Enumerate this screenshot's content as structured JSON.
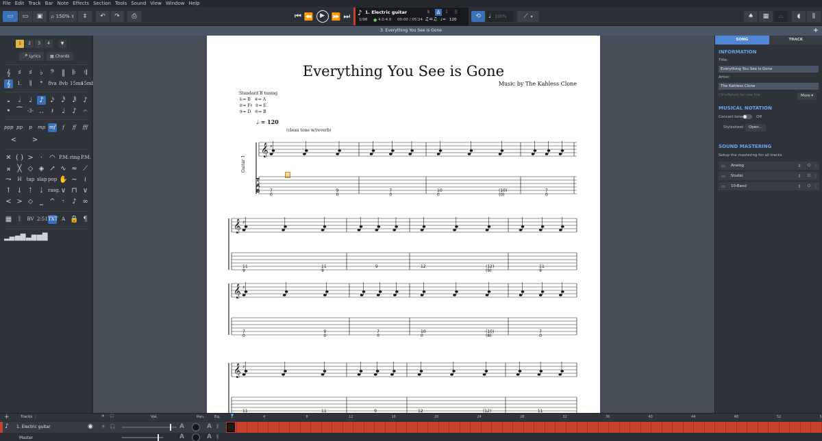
{
  "menu": [
    "File",
    "Edit",
    "Track",
    "Bar",
    "Note",
    "Effects",
    "Section",
    "Tools",
    "Sound",
    "View",
    "Window",
    "Help"
  ],
  "toolbar": {
    "zoom": "150%",
    "track_name": "1. Electric guitar",
    "bar_position": "1/98",
    "time_signature": "4.0:4.0",
    "time_position": "00:00 / 05:24",
    "tempo": "120",
    "track_number": "1",
    "string_label": "8",
    "speed": "100%"
  },
  "tab_title": "3. Everything You See is Gone",
  "palette": {
    "track_numbers": [
      "1",
      "2",
      "3",
      "4"
    ],
    "lyrics_label": "Lyrics",
    "chords_label": "Chords",
    "timecode": "2:51",
    "bv": "BV",
    "txt": "TXT"
  },
  "score": {
    "title": "Everything You See is Gone",
    "artist": "Music by The Kahless Clone",
    "tuning_title": "Standard B tuning",
    "tuning": [
      "①= B",
      "④= A",
      "②= F♯",
      "⑤= E",
      "③= D",
      "⑥= B"
    ],
    "tempo": "= 120",
    "annotation": "(clean tone w/reverb)",
    "instrument": "Guitar 1",
    "tab_letters": [
      "T",
      "A",
      "B"
    ]
  },
  "panel": {
    "tabs": [
      "SONG",
      "TRACK"
    ],
    "information_heading": "INFORMATION",
    "title_label": "Title:",
    "title_value": "Everything You See is Gone",
    "artist_label": "Artist:",
    "artist_value": "The Kahless Clone",
    "hint": "Ctrl+Return for new line",
    "more_label": "More",
    "notation_heading": "MUSICAL NOTATION",
    "concert_tone_label": "Concert tone:",
    "concert_tone_value": "Off",
    "stylesheet_label": "Stylesheet:",
    "open_label": "Open...",
    "mastering_heading": "SOUND MASTERING",
    "mastering_desc": "Setup the mastering for all tracks",
    "mastering_items": [
      "Analog",
      "Studio",
      "10-Band"
    ]
  },
  "bottom": {
    "tracks_label": "Tracks",
    "vol_label": "Vol.",
    "pan_label": "Pan.",
    "eq_label": "Eq.",
    "bar_numbers": [
      "1",
      "4",
      "8",
      "12",
      "16",
      "20",
      "24",
      "28",
      "32",
      "36",
      "40",
      "44",
      "48",
      "52",
      "56"
    ],
    "track_name": "1. Electric guitar",
    "master_label": "Master"
  },
  "colors": {
    "accent": "#3b6fb6",
    "timeline_red": "#c9412e",
    "selected_track": "#e5b53f",
    "heading_blue": "#6aa3ea"
  }
}
